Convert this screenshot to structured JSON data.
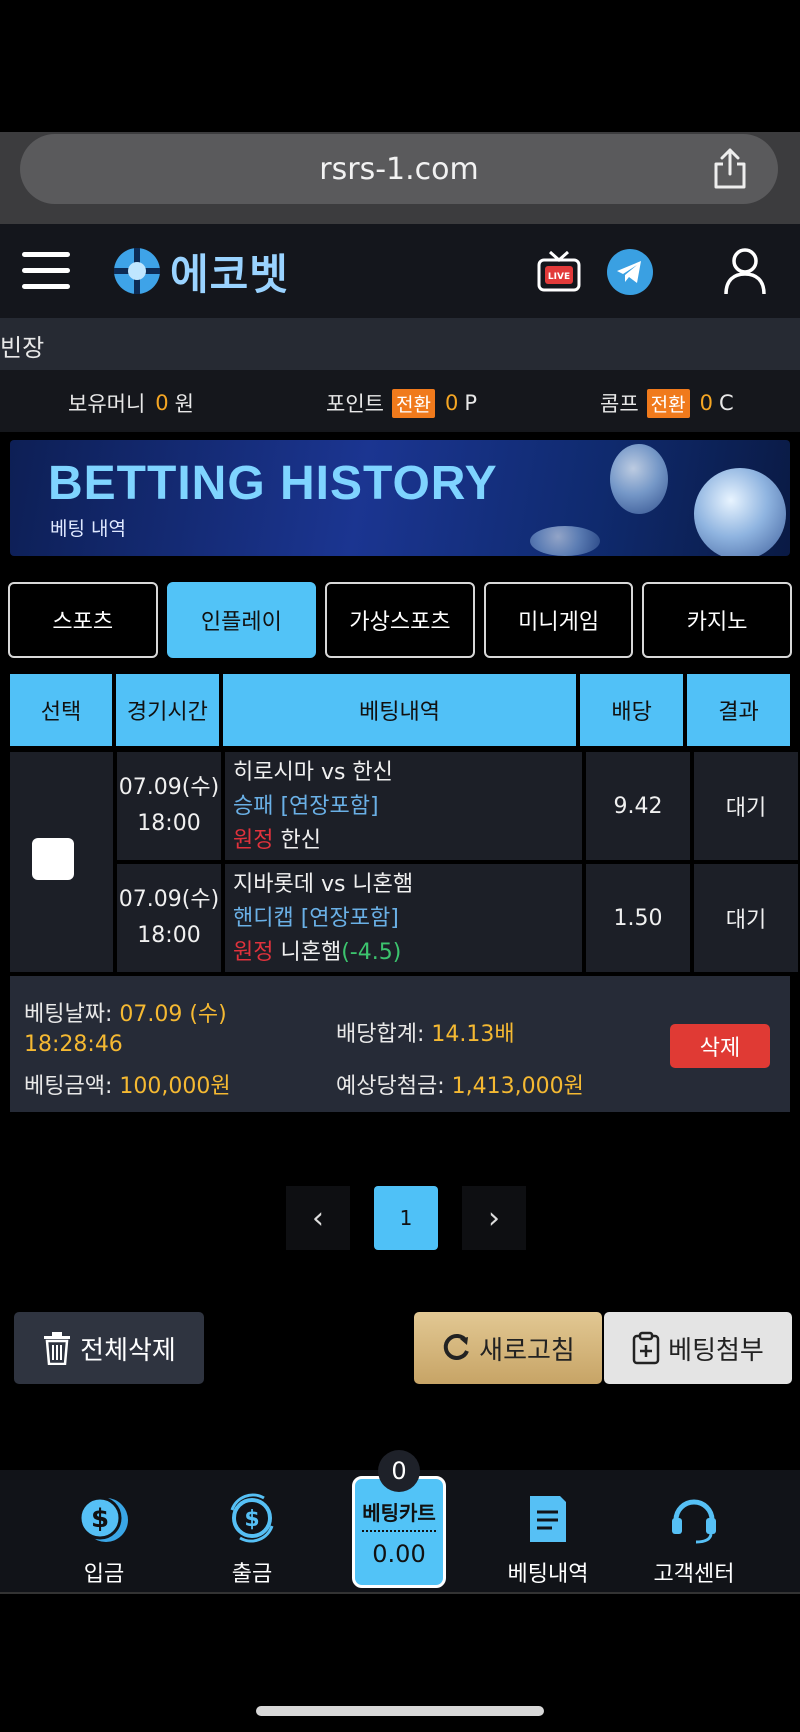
{
  "browser": {
    "url": "rsrs-1.com"
  },
  "header": {
    "logo_text": "에코벳"
  },
  "ticker": {
    "text": "빈장"
  },
  "balance": {
    "money_label": "보유머니",
    "money_value": "0",
    "money_unit": "원",
    "point_label": "포인트",
    "point_badge": "전환",
    "point_value": "0",
    "point_unit": "P",
    "comp_label": "콤프",
    "comp_badge": "전환",
    "comp_value": "0",
    "comp_unit": "C"
  },
  "banner": {
    "title": "BETTING HISTORY",
    "subtitle": "베팅 내역"
  },
  "tabs": [
    {
      "label": "스포츠"
    },
    {
      "label": "인플레이"
    },
    {
      "label": "가상스포츠"
    },
    {
      "label": "미니게임"
    },
    {
      "label": "카지노"
    }
  ],
  "active_tab": "인플레이",
  "table": {
    "headers": [
      "선택",
      "경기시간",
      "베팅내역",
      "배당",
      "결과"
    ],
    "rows": [
      {
        "date": "07.09(수)",
        "time": "18:00",
        "match": "히로시마 vs 한신",
        "market": "승패 [연장포함]",
        "pick_side": "원정",
        "pick_team": "한신",
        "pick_handicap": "",
        "odds": "9.42",
        "result": "대기"
      },
      {
        "date": "07.09(수)",
        "time": "18:00",
        "match": "지바롯데 vs 니혼햄",
        "market": "핸디캡 [연장포함]",
        "pick_side": "원정",
        "pick_team": "니혼햄",
        "pick_handicap": "(-4.5)",
        "odds": "1.50",
        "result": "대기"
      }
    ]
  },
  "summary": {
    "bet_date_label": "베팅날짜:",
    "bet_date_value": "07.09 (수)",
    "bet_time_value": "18:28:46",
    "bet_amount_label": "베팅금액:",
    "bet_amount_value": "100,000원",
    "odds_total_label": "배당합계:",
    "odds_total_value": "14.13배",
    "expected_win_label": "예상당첨금:",
    "expected_win_value": "1,413,000원",
    "delete_label": "삭제"
  },
  "pagination": {
    "prev": "‹",
    "current": "1",
    "next": "›"
  },
  "actions": {
    "delete_all": "전체삭제",
    "refresh": "새로고침",
    "attach": "베팅첨부"
  },
  "bottom_nav": {
    "deposit": "입금",
    "withdraw": "출금",
    "cart_label": "베팅카트",
    "cart_value": "0.00",
    "cart_count": "0",
    "history": "베팅내역",
    "support": "고객센터"
  },
  "colors": {
    "accent": "#52c3f7",
    "highlight": "#f5a623",
    "danger": "#e03a34"
  }
}
